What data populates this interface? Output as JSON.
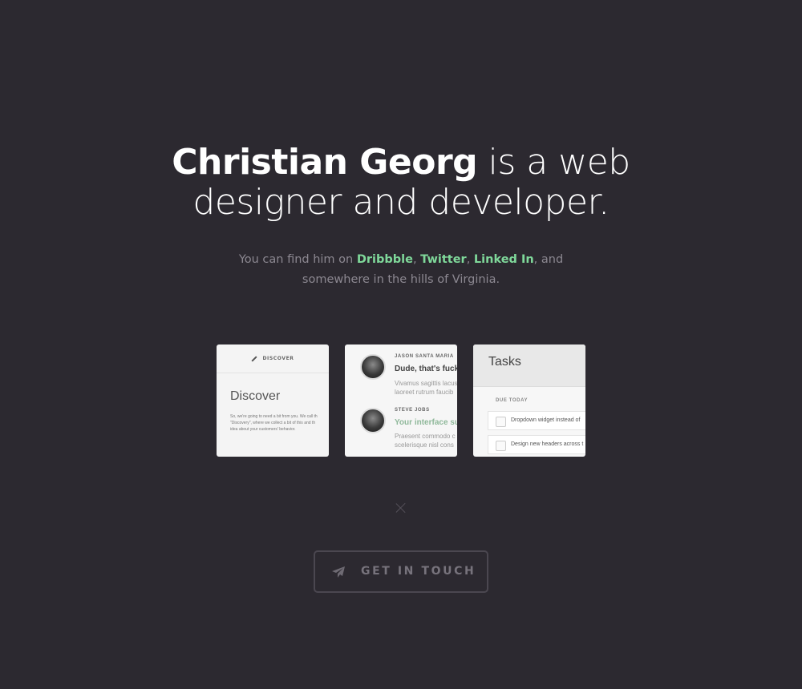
{
  "hero": {
    "name": "Christian Georg",
    "line1_rest": " is a web",
    "line2": "designer and developer."
  },
  "intro": {
    "prefix": "You can find him on ",
    "links": [
      "Dribbble",
      "Twitter",
      "Linked In"
    ],
    "sep1": ", ",
    "sep2": ", ",
    "suffix1": ", and",
    "line2": "somewhere in the hills of Virginia."
  },
  "cards": {
    "discover": {
      "header": "DISCOVER",
      "title": "Discover",
      "body_lines": [
        "So, we're going to need a bit from you. We call th",
        "\"Discovery\", where we collect a bit of this and th",
        "idea about your customers' behavior."
      ]
    },
    "messages": {
      "items": [
        {
          "name": "JASON SANTA MARIA",
          "headline": "Dude, that's fuck",
          "body": [
            "Vivamus sagittis lacus",
            "laoreet rutrum faucib"
          ]
        },
        {
          "name": "STEVE JOBS",
          "headline": "Your interface su",
          "body": [
            "Praesent commodo c",
            "scelerisque nisl cons"
          ]
        }
      ]
    },
    "tasks": {
      "title": "Tasks",
      "section": "DUE TODAY",
      "items": [
        "Dropdown widget instead of",
        "Design new headers across t"
      ]
    }
  },
  "cta": {
    "label": "GET IN TOUCH"
  },
  "colors": {
    "background": "#2c2930",
    "link": "#7fd89a",
    "muted": "#8c8891"
  },
  "icons": [
    "close-icon",
    "paper-plane-icon",
    "pencil-icon"
  ]
}
